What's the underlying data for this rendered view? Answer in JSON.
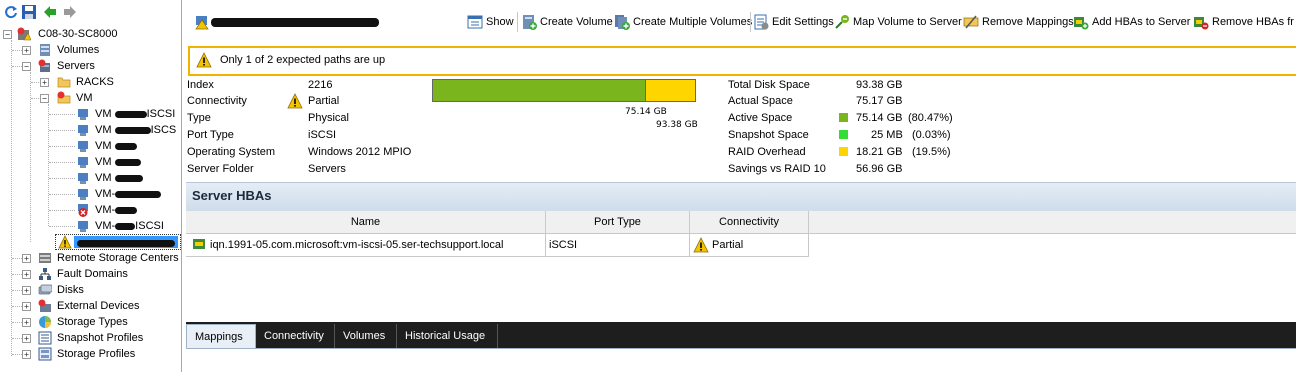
{
  "left_toolbar": {
    "icons": [
      "refresh-icon",
      "save-icon",
      "back-icon",
      "forward-icon"
    ]
  },
  "tree": {
    "root": "C08-30-SC8000",
    "volumes": "Volumes",
    "servers": "Servers",
    "racks": "RACKS",
    "vm_folder": "VM",
    "vm_children": [
      "VM",
      "VM",
      "VM",
      "VM",
      "VM",
      "VM-",
      "VM-",
      "VM-"
    ],
    "vm_suffixes": [
      "ISCSI",
      "ISCS",
      "",
      "",
      "",
      "",
      "",
      "ISCSI"
    ],
    "selected": "",
    "remote_storage_centers": "Remote Storage Centers",
    "fault_domains": "Fault Domains",
    "disks": "Disks",
    "external_devices": "External Devices",
    "storage_types": "Storage Types",
    "snapshot_profiles": "Snapshot Profiles",
    "storage_profiles": "Storage Profiles"
  },
  "toolbar": {
    "show": "Show",
    "create_volume": "Create Volume",
    "create_multiple_volumes": "Create Multiple Volumes",
    "edit_settings": "Edit Settings",
    "map_volume_to_server": "Map Volume to Server",
    "remove_mappings": "Remove Mappings",
    "add_hbas_to_server": "Add HBAs to Server",
    "remove_hbas": "Remove HBAs fr"
  },
  "warning": {
    "text": "Only 1 of 2 expected paths are up"
  },
  "info": {
    "labels": [
      "Index",
      "Connectivity",
      "Type",
      "Port Type",
      "Operating System",
      "Server Folder"
    ],
    "values": [
      "2216",
      "Partial",
      "Physical",
      "iSCSI",
      "Windows 2012 MPIO",
      "Servers"
    ]
  },
  "usage_bar": {
    "used_label": "75.14 GB",
    "total_label": "93.38 GB",
    "used_fraction": 0.8047,
    "colors": {
      "used": "#7ab51d",
      "raid": "#ffd500"
    }
  },
  "space": {
    "labels": [
      "Total Disk Space",
      "Actual Space",
      "Active Space",
      "Snapshot Space",
      "RAID Overhead",
      "Savings vs RAID 10"
    ],
    "values": [
      "93.38 GB",
      "75.17 GB",
      "75.14 GB",
      "25 MB",
      "18.21 GB",
      "56.96 GB"
    ],
    "percents": [
      "",
      "",
      "(80.47%)",
      "(0.03%)",
      "(19.5%)",
      ""
    ],
    "swatches": [
      "",
      "",
      "#7ab51d",
      "#33dd33",
      "#ffd500",
      ""
    ]
  },
  "hbas": {
    "title": "Server HBAs",
    "columns": [
      "Name",
      "Port Type",
      "Connectivity"
    ],
    "rows": [
      {
        "name": "iqn.1991-05.com.microsoft:vm-iscsi-05.ser-techsupport.local",
        "port_type": "iSCSI",
        "connectivity": "Partial"
      }
    ]
  },
  "tabs": [
    "Mappings",
    "Connectivity",
    "Volumes",
    "Historical Usage"
  ],
  "active_tab": "Mappings"
}
